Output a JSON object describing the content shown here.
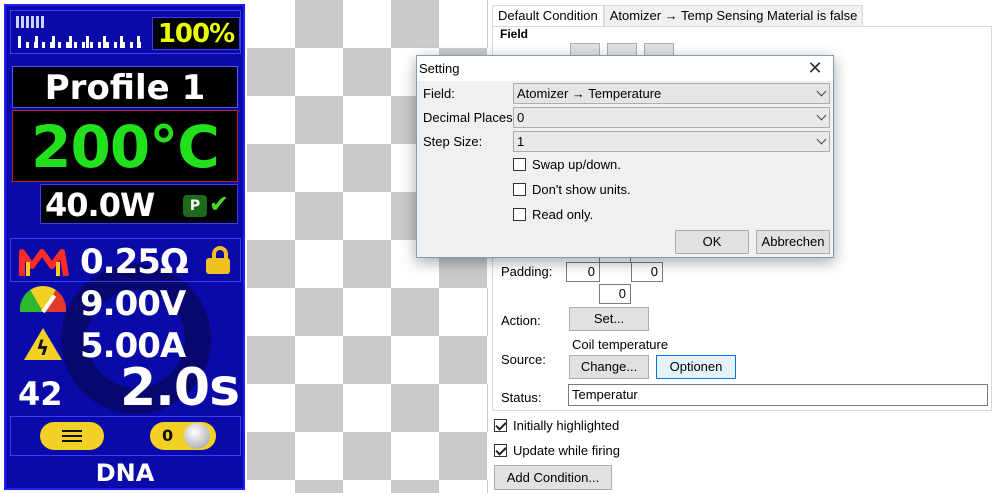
{
  "device": {
    "battery_percent": "100%",
    "profile": "Profile 1",
    "temperature": "200°C",
    "wattage": "40.0W",
    "preheat_icon_text": "P",
    "resistance": "0.25Ω",
    "voltage": "9.00V",
    "current": "5.00A",
    "puff_count": "42",
    "puff_time": "2.0s",
    "toggle_value": "0",
    "brand": "DNA",
    "icons": [
      "battery-bars-icon",
      "coil-icon",
      "lock-open-icon",
      "gauge-icon",
      "warning-icon",
      "menu-icon",
      "toggle-icon",
      "check-icon"
    ],
    "colors": {
      "background": "#0a0aa8",
      "temperature": "#22e01c",
      "battery": "#eaff00",
      "accent": "#f2d024"
    }
  },
  "tabs": [
    {
      "label": "Default Condition"
    },
    {
      "label": "Atomizer → Temp Sensing Material is false"
    }
  ],
  "panel": {
    "field_heading": "Field",
    "padding_label": "Padding:",
    "padding_left": "0",
    "padding_right": "0",
    "padding_bottom": "0",
    "action_label": "Action:",
    "action_button": "Set...",
    "source_label": "Source:",
    "source_name": "Coil temperature",
    "change_button": "Change...",
    "options_button": "Optionen",
    "status_label": "Status:",
    "status_value": "Temperatur"
  },
  "checks": {
    "initially_highlighted": {
      "label": "Initially highlighted",
      "checked": true
    },
    "update_while_firing": {
      "label": "Update while firing",
      "checked": true
    }
  },
  "add_condition_button": "Add Condition...",
  "dialog": {
    "title": "Setting",
    "field_label": "Field:",
    "field_value": "Atomizer → Temperature",
    "decimal_label": "Decimal Places:",
    "decimal_value": "0",
    "step_label": "Step Size:",
    "step_value": "1",
    "swap_label": "Swap up/down.",
    "no_units_label": "Don't show units.",
    "read_only_label": "Read only.",
    "ok_button": "OK",
    "cancel_button": "Abbrechen"
  }
}
